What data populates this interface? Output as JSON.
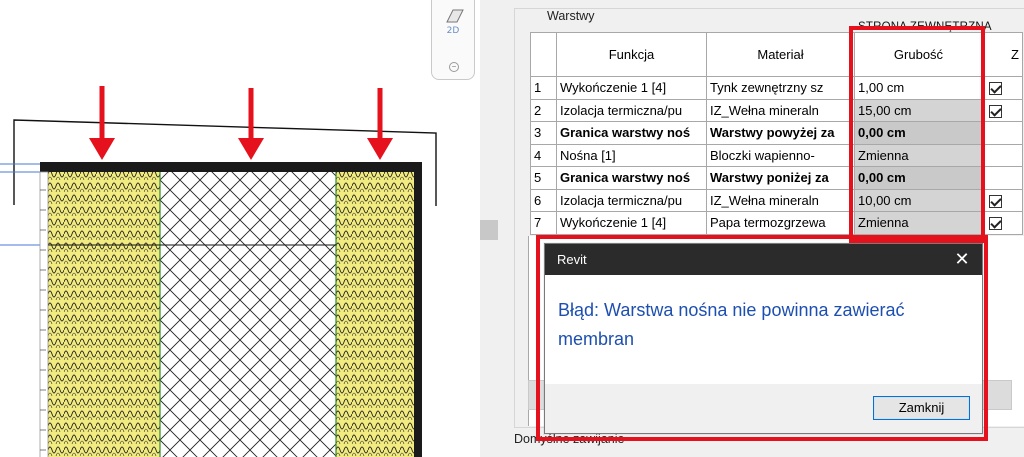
{
  "drawing": {
    "arrow_color": "#e5111c",
    "insulation_color": "#f2ec80",
    "viewcube_label": "2D"
  },
  "panel": {
    "group_title": "Warstwy",
    "side_label": "STRONA ZEWNĘTRZNA",
    "bottom_label": "Domyślne zawijanie",
    "columns": [
      "Funkcja",
      "Materiał",
      "Grubość",
      "Z"
    ],
    "rows": [
      {
        "num": "1",
        "func": "Wykończenie 1 [4]",
        "mat": "Tynk zewnętrzny sz",
        "thk": "1,00 cm",
        "wrap": "checked"
      },
      {
        "num": "2",
        "func": "Izolacja termiczna/pu",
        "mat": "IZ_Wełna mineraln",
        "thk": "15,00 cm",
        "wrap": "checked"
      },
      {
        "num": "3",
        "func": "Granica warstwy noś",
        "mat": "Warstwy powyżej za",
        "thk": "0,00 cm",
        "wrap": "none"
      },
      {
        "num": "4",
        "func": "Nośna [1]",
        "mat": "Bloczki wapienno-",
        "thk": "Zmienna",
        "wrap": "plain"
      },
      {
        "num": "5",
        "func": "Granica warstwy noś",
        "mat": "Warstwy poniżej za",
        "thk": "0,00 cm",
        "wrap": "none"
      },
      {
        "num": "6",
        "func": "Izolacja termiczna/pu",
        "mat": "IZ_Wełna mineraln",
        "thk": "10,00 cm",
        "wrap": "checked"
      },
      {
        "num": "7",
        "func": "Wykończenie 1 [4]",
        "mat": "Papa termozgrzewa",
        "thk": "Zmienna",
        "wrap": "checked"
      }
    ]
  },
  "dialog": {
    "title": "Revit",
    "close_glyph": "✕",
    "message": "Błąd: Warstwa nośna nie powinna zawierać membran",
    "button_label": "Zamknij",
    "message_color": "#1d4fb0"
  },
  "highlight_color": "#e5111c"
}
